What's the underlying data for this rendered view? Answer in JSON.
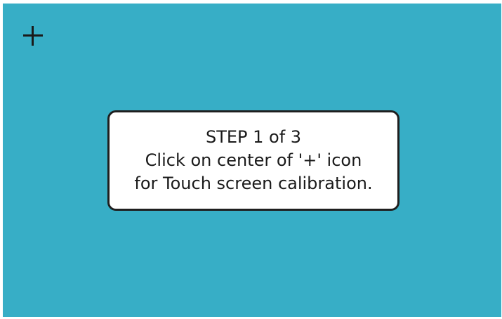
{
  "calibration": {
    "target_icon": "plus-crosshair-icon",
    "background_color": "#37aec6",
    "dialog": {
      "step_text": "STEP 1 of 3",
      "instruction_line1": "Click on center of '+' icon",
      "instruction_line2": "for Touch screen calibration."
    }
  }
}
